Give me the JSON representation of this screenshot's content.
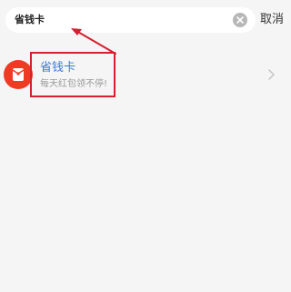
{
  "search": {
    "query": "省钱卡",
    "cancel_label": "取消"
  },
  "result": {
    "title": "省钱卡",
    "description": "每天红包领不停!"
  },
  "icons": {
    "clear": "clear-icon",
    "app": "red-envelope-icon",
    "chevron": "chevron-right-icon"
  },
  "colors": {
    "app_icon": "#ef3b24",
    "result_title": "#3a7bd5",
    "annotation": "#d4202f"
  }
}
